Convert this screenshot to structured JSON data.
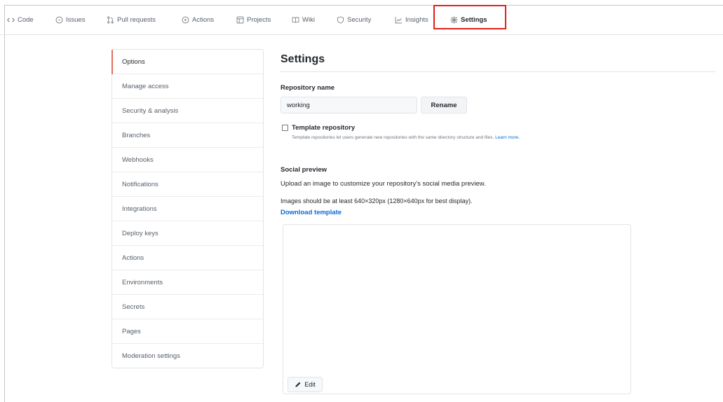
{
  "topnav": {
    "tabs": [
      {
        "label": "Code",
        "icon": "code-icon"
      },
      {
        "label": "Issues",
        "icon": "issue-icon"
      },
      {
        "label": "Pull requests",
        "icon": "pull-request-icon"
      },
      {
        "label": "Actions",
        "icon": "play-icon"
      },
      {
        "label": "Projects",
        "icon": "project-icon"
      },
      {
        "label": "Wiki",
        "icon": "book-icon"
      },
      {
        "label": "Security",
        "icon": "shield-icon"
      },
      {
        "label": "Insights",
        "icon": "graph-icon"
      },
      {
        "label": "Settings",
        "icon": "gear-icon",
        "active": true
      }
    ],
    "highlight_color": "#e0201c",
    "active_underline_color": "#fd8c73"
  },
  "sidebar": {
    "items": [
      {
        "label": "Options",
        "selected": true
      },
      {
        "label": "Manage access"
      },
      {
        "label": "Security & analysis"
      },
      {
        "label": "Branches"
      },
      {
        "label": "Webhooks"
      },
      {
        "label": "Notifications"
      },
      {
        "label": "Integrations"
      },
      {
        "label": "Deploy keys"
      },
      {
        "label": "Actions"
      },
      {
        "label": "Environments"
      },
      {
        "label": "Secrets"
      },
      {
        "label": "Pages"
      },
      {
        "label": "Moderation settings"
      }
    ],
    "selected_accent_color": "#e16f5a"
  },
  "main": {
    "title": "Settings",
    "repo_name_label": "Repository name",
    "repo_name_value": "working",
    "rename_label": "Rename",
    "template_label": "Template repository",
    "template_checked": false,
    "template_note": "Template repositories let users generate new repositories with the same directory structure and files.",
    "learn_more": "Learn more.",
    "social_preview_label": "Social preview",
    "social_preview_desc": "Upload an image to customize your repository's social media preview.",
    "image_size_note": "Images should be at least 640×320px (1280×640px for best display).",
    "download_template": "Download template",
    "edit_label": "Edit",
    "link_color": "#0969da"
  }
}
